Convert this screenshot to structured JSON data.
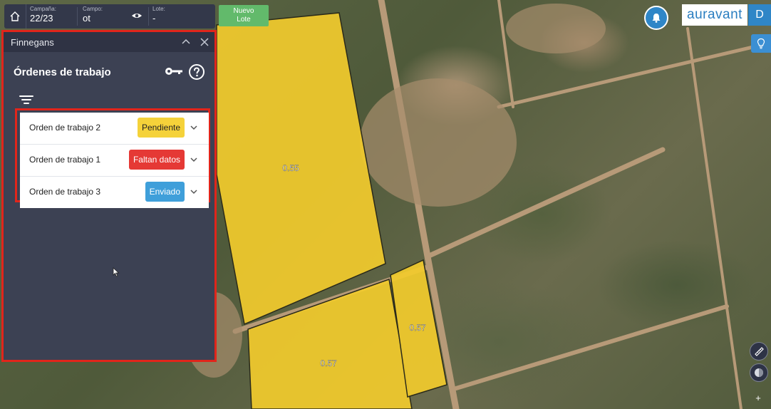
{
  "topbar": {
    "campana_label": "Campaña:",
    "campana_value": "22/23",
    "campo_label": "Campo:",
    "campo_value": "ot",
    "lote_label": "Lote:",
    "lote_value": "-"
  },
  "nuevo_lote": {
    "line1": "Nuevo",
    "line2": "Lote"
  },
  "brand": "auravant",
  "user_initial": "D",
  "panel": {
    "header": "Finnegans",
    "title": "Órdenes de trabajo",
    "orders": [
      {
        "name": "Orden de trabajo 2",
        "status": "Pendiente",
        "status_color": "#f5d23a",
        "status_text_color": "#222222"
      },
      {
        "name": "Orden de trabajo 1",
        "status": "Faltan datos",
        "status_color": "#e53935",
        "status_text_color": "#ffffff"
      },
      {
        "name": "Orden de trabajo 3",
        "status": "Enviado",
        "status_color": "#3f9fda",
        "status_text_color": "#ffffff"
      }
    ]
  },
  "map": {
    "plots": [
      {
        "label": "0.55"
      },
      {
        "label": "0.57"
      },
      {
        "label": "0.57"
      }
    ],
    "plot_color": "#f2cb2c"
  },
  "controls": {
    "plus": "+"
  },
  "colors": {
    "accent": "#2f86c7",
    "highlight": "#e1251b",
    "panel_bg": "#3c4153"
  }
}
